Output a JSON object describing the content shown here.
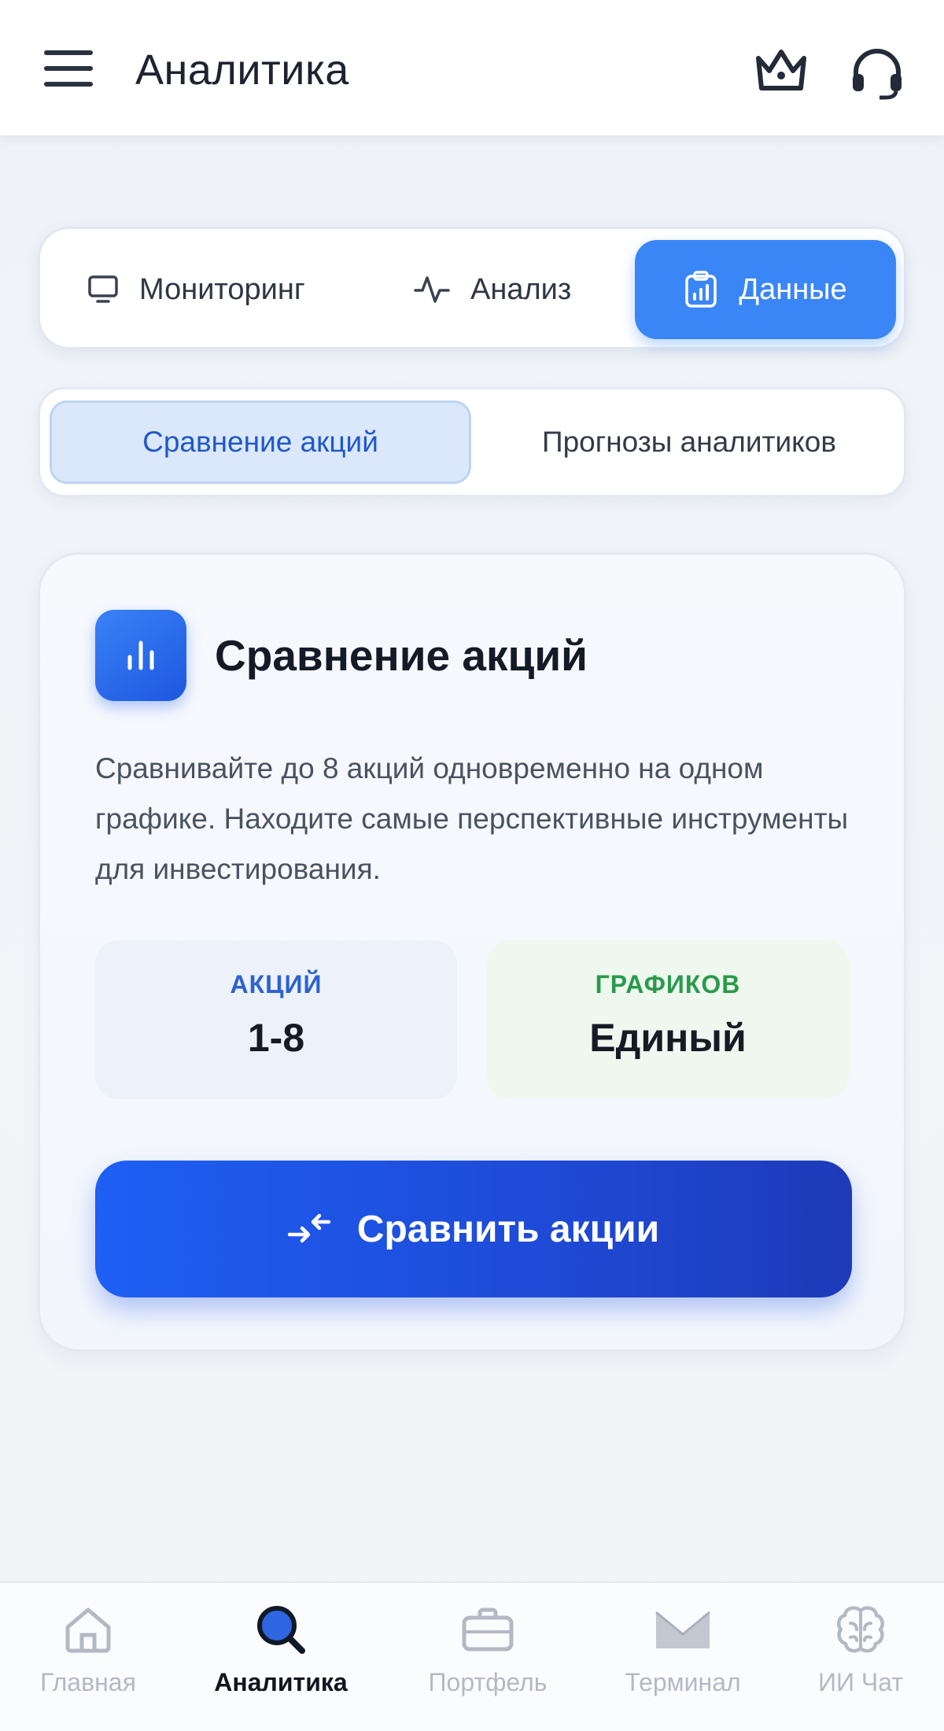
{
  "header": {
    "title": "Аналитика",
    "icons": {
      "menu": "menu-icon",
      "premium": "crown-icon",
      "support": "headset-icon"
    }
  },
  "main_tabs": [
    {
      "label": "Мониторинг",
      "icon": "monitor-icon",
      "active": false
    },
    {
      "label": "Анализ",
      "icon": "activity-icon",
      "active": false
    },
    {
      "label": "Данные",
      "icon": "clipboard-chart-icon",
      "active": true
    }
  ],
  "sub_tabs": [
    {
      "label": "Сравнение акций",
      "active": true
    },
    {
      "label": "Прогнозы аналитиков",
      "active": false
    }
  ],
  "card": {
    "icon": "bar-chart-icon",
    "title": "Сравнение акций",
    "description": "Сравнивайте до 8 акций одновременно на одном графике. Находите самые перспективные инструменты для инвестирования.",
    "stats": [
      {
        "label": "АКЦИЙ",
        "value": "1-8",
        "color": "#2d62d0"
      },
      {
        "label": "ГРАФИКОВ",
        "value": "Единый",
        "color": "#2a9a4a"
      }
    ],
    "button": {
      "label": "Сравнить акции",
      "icon": "compare-arrows-icon"
    }
  },
  "bottom_nav": [
    {
      "label": "Главная",
      "icon": "home-icon",
      "active": false
    },
    {
      "label": "Аналитика",
      "icon": "search-icon",
      "active": true
    },
    {
      "label": "Портфель",
      "icon": "briefcase-icon",
      "active": false
    },
    {
      "label": "Терминал",
      "icon": "terminal-icon",
      "active": false
    },
    {
      "label": "ИИ Чат",
      "icon": "brain-icon",
      "active": false
    }
  ],
  "colors": {
    "accent": "#3a86f7",
    "button": "#1e5ff4",
    "text_dark": "#141a26",
    "inactive_nav": "#b3b9c4"
  }
}
